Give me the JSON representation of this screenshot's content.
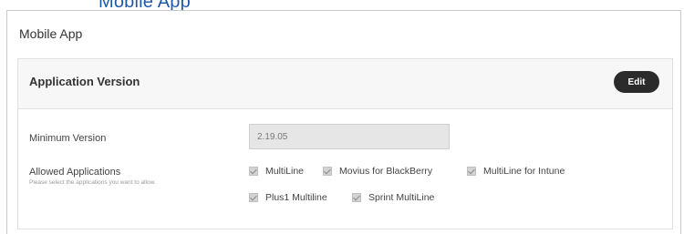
{
  "header": {
    "link_text": "Mobile App"
  },
  "section": {
    "title": "Mobile App"
  },
  "panel": {
    "title": "Application Version",
    "edit_label": "Edit"
  },
  "min_version": {
    "label": "Minimum Version",
    "value": "2.19.05"
  },
  "allowed_apps": {
    "label": "Allowed Applications",
    "helper": "Please select the applications you want to allow.",
    "items": [
      {
        "label": "MultiLine",
        "checked": true
      },
      {
        "label": "Movius for BlackBerry",
        "checked": true
      },
      {
        "label": "MultiLine for Intune",
        "checked": true
      },
      {
        "label": "Plus1 Multiline",
        "checked": true
      },
      {
        "label": "Sprint MultiLine",
        "checked": true
      }
    ]
  }
}
